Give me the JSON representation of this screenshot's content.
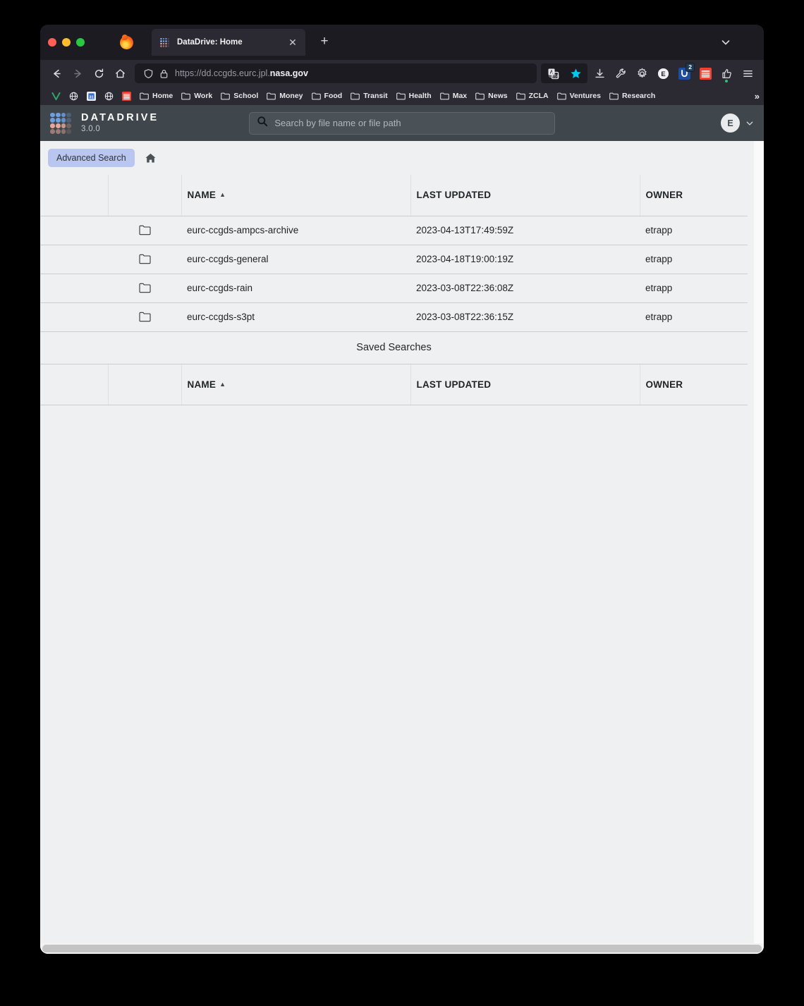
{
  "browser": {
    "tab": {
      "title": "DataDrive: Home",
      "favicon": "datadrive-dotgrid-icon",
      "close_label": "✕",
      "newtab_label": "+"
    },
    "tab_list_icon": "chevron-down-icon",
    "nav": {
      "back_icon": "←",
      "forward_icon": "→",
      "reload_icon": "↻",
      "home_icon": "⌂"
    },
    "urlbar": {
      "shield_icon": "shield-icon",
      "lock_icon": "lock-icon",
      "url_prefix": "https://dd.ccgds.eurc.jpl.",
      "url_domain": "nasa.gov"
    },
    "toolbar_icons": [
      {
        "name": "translate-icon",
        "glyph": "A"
      },
      {
        "name": "bookmark-star-icon",
        "glyph": "★",
        "color": "#00c8f0"
      },
      {
        "name": "downloads-icon",
        "glyph": "⬇"
      },
      {
        "name": "wrench-icon",
        "glyph": "🔧"
      },
      {
        "name": "gear-icon",
        "glyph": "⚙"
      },
      {
        "name": "extension-e-icon",
        "glyph": "E"
      },
      {
        "name": "u-extension-icon",
        "glyph": "U",
        "badge": "2"
      },
      {
        "name": "red-stack-icon",
        "glyph": "≡"
      },
      {
        "name": "thumbs-up-icon",
        "glyph": "👍"
      },
      {
        "name": "hamburger-menu-icon",
        "glyph": "☰"
      }
    ],
    "bookmarks": [
      {
        "label": "",
        "icon": "v-logo-icon"
      },
      {
        "label": "",
        "icon": "globe-icon"
      },
      {
        "label": "",
        "icon": "blue-app-icon"
      },
      {
        "label": "",
        "icon": "globe-icon"
      },
      {
        "label": "",
        "icon": "red-stack-icon"
      },
      {
        "label": "Home",
        "icon": "folder-icon"
      },
      {
        "label": "Work",
        "icon": "folder-icon"
      },
      {
        "label": "School",
        "icon": "folder-icon"
      },
      {
        "label": "Money",
        "icon": "folder-icon"
      },
      {
        "label": "Food",
        "icon": "folder-icon"
      },
      {
        "label": "Transit",
        "icon": "folder-icon"
      },
      {
        "label": "Health",
        "icon": "folder-icon"
      },
      {
        "label": "Max",
        "icon": "folder-icon"
      },
      {
        "label": "News",
        "icon": "folder-icon"
      },
      {
        "label": "ZCLA",
        "icon": "folder-icon"
      },
      {
        "label": "Ventures",
        "icon": "folder-icon"
      },
      {
        "label": "Research",
        "icon": "folder-icon"
      }
    ],
    "bookmarks_overflow": "»"
  },
  "app": {
    "brand_name": "DATADRIVE",
    "version": "3.0.0",
    "search": {
      "placeholder": "Search by file name or file path",
      "value": "",
      "icon": "search-icon"
    },
    "user": {
      "initial": "E",
      "chevron": "chevron-down-icon"
    },
    "toolbar": {
      "advanced_search_label": "Advanced Search",
      "home_icon": "home-icon"
    },
    "files_table": {
      "columns": [
        "",
        "",
        "NAME",
        "LAST UPDATED",
        "OWNER"
      ],
      "sort_column": "NAME",
      "sort_direction": "asc",
      "sort_arrow": "▲",
      "rows": [
        {
          "icon": "folder-icon",
          "name": "eurc-ccgds-ampcs-archive",
          "last_updated": "2023-04-13T17:49:59Z",
          "owner": "etrapp"
        },
        {
          "icon": "folder-icon",
          "name": "eurc-ccgds-general",
          "last_updated": "2023-04-18T19:00:19Z",
          "owner": "etrapp"
        },
        {
          "icon": "folder-icon",
          "name": "eurc-ccgds-rain",
          "last_updated": "2023-03-08T22:36:08Z",
          "owner": "etrapp"
        },
        {
          "icon": "folder-icon",
          "name": "eurc-ccgds-s3pt",
          "last_updated": "2023-03-08T22:36:15Z",
          "owner": "etrapp"
        }
      ]
    },
    "saved_searches": {
      "title": "Saved Searches",
      "columns": [
        "",
        "",
        "NAME",
        "LAST UPDATED",
        "OWNER"
      ],
      "sort_column": "NAME",
      "sort_direction": "asc",
      "sort_arrow": "▲",
      "rows": []
    }
  },
  "colors": {
    "app_header_bg": "#3f474d",
    "content_bg": "#eef0f2",
    "advanced_search_bg": "#b9c6ef",
    "browser_chrome": "#2b2a33",
    "browser_dark": "#1c1b22"
  }
}
